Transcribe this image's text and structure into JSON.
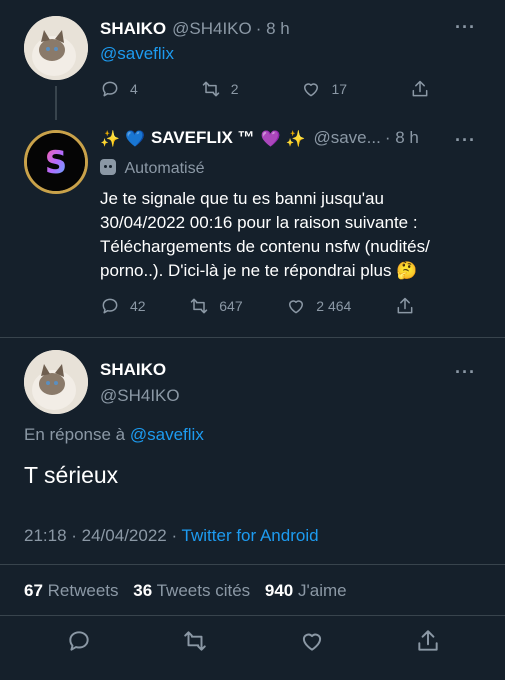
{
  "tweet1": {
    "name": "SHAIKO",
    "handle": "@SH4IKO",
    "time": "· 8 h",
    "mention": "@saveflix",
    "replies": "4",
    "retweets": "2",
    "likes": "17"
  },
  "tweet2": {
    "name_prefix": "✨ 💙",
    "name": "SAVEFLIX ™",
    "name_suffix": "💜 ✨",
    "handle": "@save...",
    "time": "· 8 h",
    "automated_label": "Automatisé",
    "text_lines": [
      "Je te signale que tu es banni jusqu'au",
      "30/04/2022 00:16 pour la raison suivante :",
      "Téléchargements de contenu nsfw (nudités/",
      "porno..). D'ici-là je ne te répondrai plus 🤔"
    ],
    "replies": "42",
    "retweets": "647",
    "likes": "2 464",
    "avatar_letter": "S"
  },
  "main_tweet": {
    "name": "SHAIKO",
    "handle": "@SH4IKO",
    "reply_prefix": "En réponse à",
    "reply_to": "@saveflix",
    "text": "T sérieux",
    "timestamp": "21:18 · 24/04/2022 ·",
    "source": "Twitter for Android",
    "retweets_count": "67",
    "retweets_label": "Retweets",
    "quotes_count": "36",
    "quotes_label": "Tweets cités",
    "likes_count": "940",
    "likes_label": "J'aime"
  },
  "more_label": "···",
  "icons": {
    "reply": "reply-icon",
    "retweet": "retweet-icon",
    "like": "heart-icon",
    "share": "share-icon"
  },
  "colors": {
    "background": "#15202b",
    "accent": "#1d9bf0",
    "muted": "#8b98a5",
    "divider": "#38444d"
  }
}
